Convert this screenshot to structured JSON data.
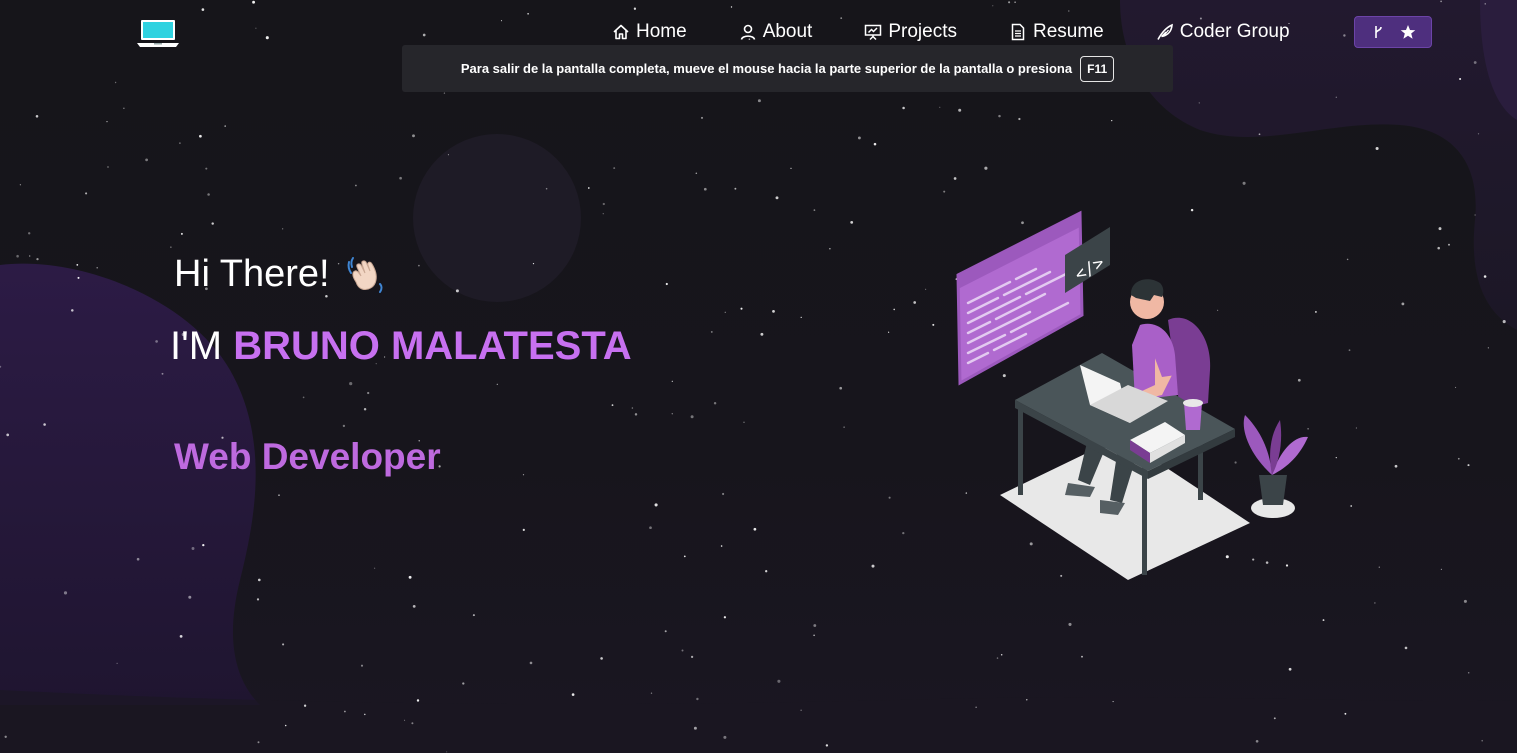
{
  "nav": {
    "logo_icon": "laptop-icon",
    "items": [
      {
        "label": "Home",
        "icon": "home-icon"
      },
      {
        "label": "About",
        "icon": "user-icon"
      },
      {
        "label": "Projects",
        "icon": "presentation-icon"
      },
      {
        "label": "Resume",
        "icon": "document-icon"
      },
      {
        "label": "Coder Group",
        "icon": "feather-icon"
      }
    ],
    "github_button": {
      "icons": [
        "git-fork-icon",
        "star-icon"
      ]
    }
  },
  "fullscreen_notice": {
    "message": "Para salir de la pantalla completa, mueve el mouse hacia la parte superior de la pantalla o presiona",
    "key": "F11"
  },
  "hero": {
    "greeting": "Hi There!",
    "greeting_icon": "waving-hand-icon",
    "intro_prefix": "I'M",
    "name": "BRUNO MALATESTA",
    "role": "Web Developer"
  },
  "colors": {
    "accent": "#c770f0",
    "background": "#17161b",
    "button_bg": "#4e2f7e"
  }
}
